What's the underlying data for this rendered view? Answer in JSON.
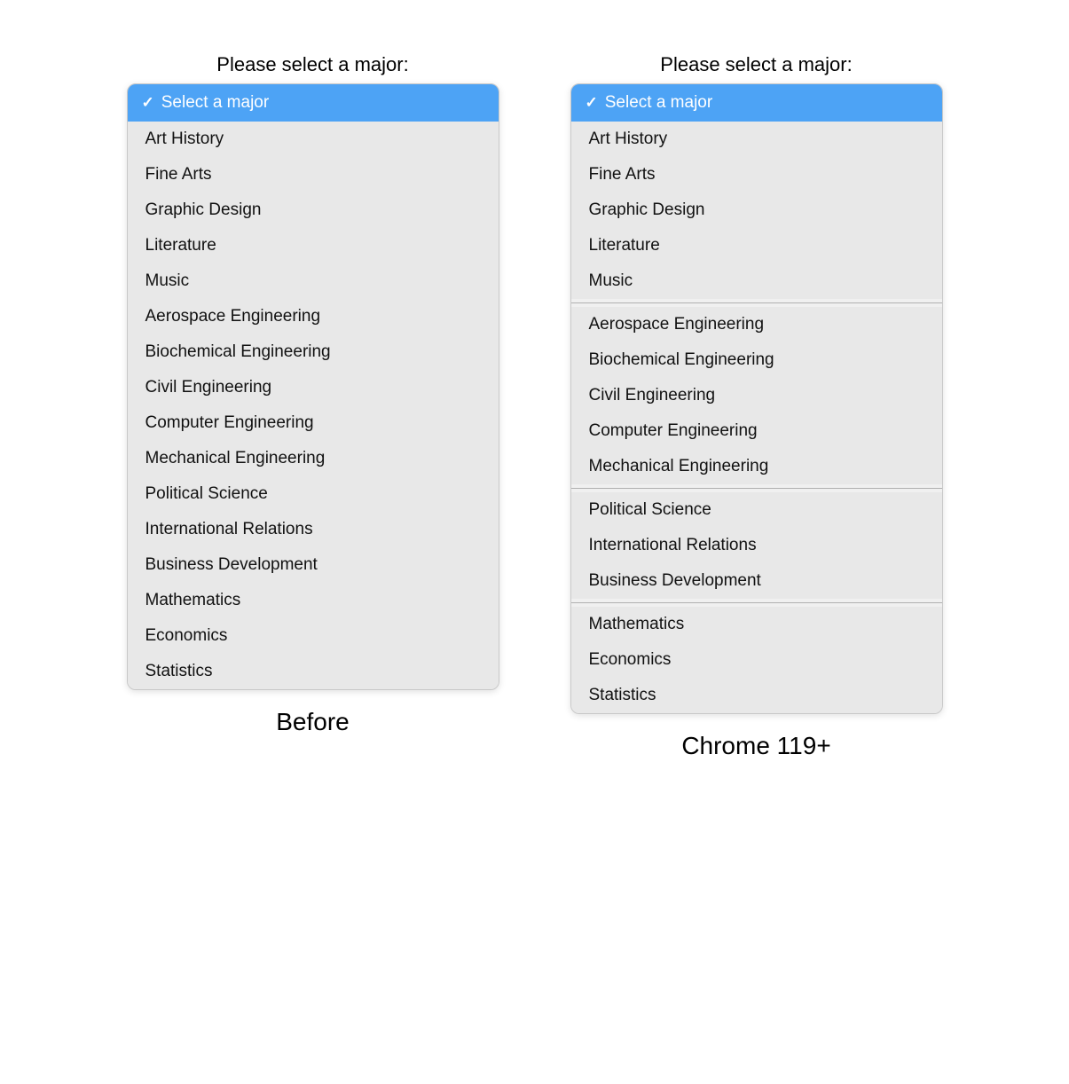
{
  "before": {
    "label": "Please select a major:",
    "caption": "Before",
    "selected": "Select a major",
    "options": [
      "Art History",
      "Fine Arts",
      "Graphic Design",
      "Literature",
      "Music",
      "Aerospace Engineering",
      "Biochemical Engineering",
      "Civil Engineering",
      "Computer Engineering",
      "Mechanical Engineering",
      "Political Science",
      "International Relations",
      "Business Development",
      "Mathematics",
      "Economics",
      "Statistics"
    ]
  },
  "chrome": {
    "label": "Please select a major:",
    "caption": "Chrome 119+",
    "selected": "Select a major",
    "groups": [
      [
        "Art History",
        "Fine Arts",
        "Graphic Design",
        "Literature",
        "Music"
      ],
      [
        "Aerospace Engineering",
        "Biochemical Engineering",
        "Civil Engineering",
        "Computer Engineering",
        "Mechanical Engineering"
      ],
      [
        "Political Science",
        "International Relations",
        "Business Development"
      ],
      [
        "Mathematics",
        "Economics",
        "Statistics"
      ]
    ]
  },
  "icons": {
    "checkmark": "✓"
  }
}
